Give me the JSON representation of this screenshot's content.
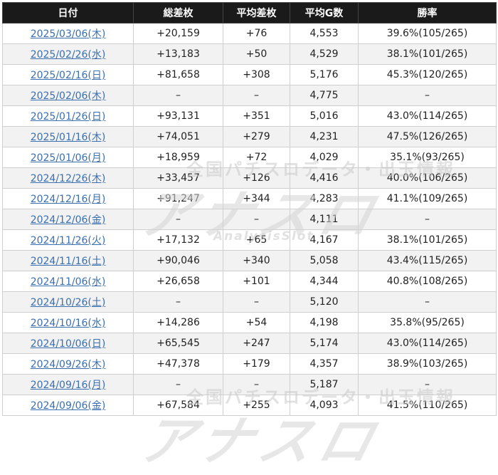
{
  "table": {
    "headers": [
      "日付",
      "総差枚",
      "平均差枚",
      "平均G数",
      "勝率"
    ],
    "rows": [
      {
        "date": "2025/03/06(木)",
        "total": "+20,159",
        "avg_diff": "+76",
        "avg_games": "4,553",
        "win_rate": "39.6%(105/265)"
      },
      {
        "date": "2025/02/26(水)",
        "total": "+13,183",
        "avg_diff": "+50",
        "avg_games": "4,529",
        "win_rate": "38.1%(101/265)"
      },
      {
        "date": "2025/02/16(日)",
        "total": "+81,658",
        "avg_diff": "+308",
        "avg_games": "5,176",
        "win_rate": "45.3%(120/265)"
      },
      {
        "date": "2025/02/06(木)",
        "total": "–",
        "avg_diff": "–",
        "avg_games": "4,775",
        "win_rate": "–"
      },
      {
        "date": "2025/01/26(日)",
        "total": "+93,131",
        "avg_diff": "+351",
        "avg_games": "5,016",
        "win_rate": "43.0%(114/265)"
      },
      {
        "date": "2025/01/16(木)",
        "total": "+74,051",
        "avg_diff": "+279",
        "avg_games": "4,231",
        "win_rate": "47.5%(126/265)"
      },
      {
        "date": "2025/01/06(月)",
        "total": "+18,959",
        "avg_diff": "+72",
        "avg_games": "4,029",
        "win_rate": "35.1%(93/265)"
      },
      {
        "date": "2024/12/26(木)",
        "total": "+33,457",
        "avg_diff": "+126",
        "avg_games": "4,416",
        "win_rate": "40.0%(106/265)"
      },
      {
        "date": "2024/12/16(月)",
        "total": "+91,247",
        "avg_diff": "+344",
        "avg_games": "4,283",
        "win_rate": "41.1%(109/265)"
      },
      {
        "date": "2024/12/06(金)",
        "total": "–",
        "avg_diff": "–",
        "avg_games": "4,111",
        "win_rate": "–"
      },
      {
        "date": "2024/11/26(火)",
        "total": "+17,132",
        "avg_diff": "+65",
        "avg_games": "4,167",
        "win_rate": "38.1%(101/265)"
      },
      {
        "date": "2024/11/16(土)",
        "total": "+90,046",
        "avg_diff": "+340",
        "avg_games": "5,058",
        "win_rate": "43.4%(115/265)"
      },
      {
        "date": "2024/11/06(水)",
        "total": "+26,658",
        "avg_diff": "+101",
        "avg_games": "4,344",
        "win_rate": "40.8%(108/265)"
      },
      {
        "date": "2024/10/26(土)",
        "total": "–",
        "avg_diff": "–",
        "avg_games": "5,120",
        "win_rate": "–"
      },
      {
        "date": "2024/10/16(水)",
        "total": "+14,286",
        "avg_diff": "+54",
        "avg_games": "4,198",
        "win_rate": "35.8%(95/265)"
      },
      {
        "date": "2024/10/06(日)",
        "total": "+65,545",
        "avg_diff": "+247",
        "avg_games": "5,174",
        "win_rate": "43.0%(114/265)"
      },
      {
        "date": "2024/09/26(木)",
        "total": "+47,378",
        "avg_diff": "+179",
        "avg_games": "4,357",
        "win_rate": "38.9%(103/265)"
      },
      {
        "date": "2024/09/16(月)",
        "total": "–",
        "avg_diff": "–",
        "avg_games": "5,187",
        "win_rate": "–"
      },
      {
        "date": "2024/09/06(金)",
        "total": "+67,584",
        "avg_diff": "+255",
        "avg_games": "4,093",
        "win_rate": "41.5%(110/265)"
      }
    ]
  },
  "watermark": {
    "tagline": "全国パチスロデータ・出玉情報",
    "logo": "アナスロ",
    "sub": "AnalysisSlot"
  },
  "colors": {
    "header_bg": "#1a1a1a",
    "link": "#3a6fb0",
    "row_alt": "#f2f2f2"
  }
}
